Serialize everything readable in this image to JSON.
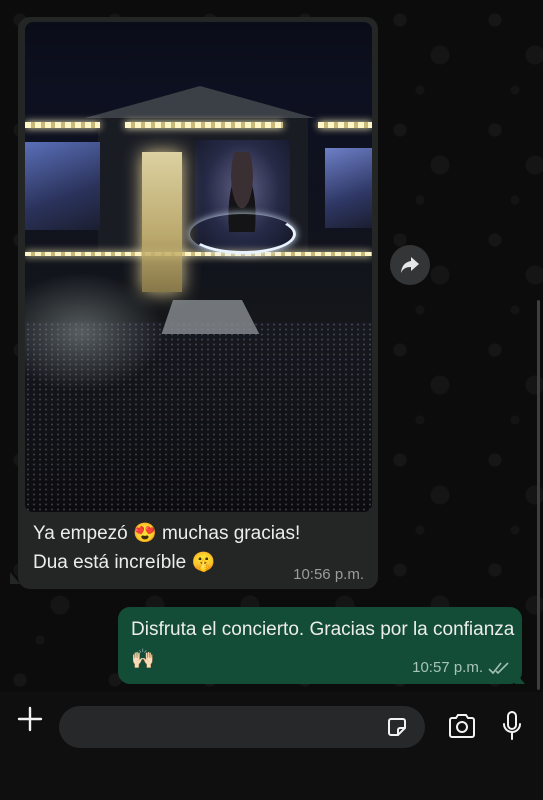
{
  "incoming": {
    "caption_line1": "Ya empezó",
    "emoji1": "😍",
    "caption_line1b": "muchas gracias!",
    "caption_line2": "Dua está increíble",
    "emoji2": "🤫",
    "time": "10:56 p.m.",
    "image_icon": "concert-photo"
  },
  "forward": {
    "icon": "forward-arrow-icon"
  },
  "outgoing": {
    "text": "Disfruta el concierto. Gracias por la confianza",
    "emoji": "🙌🏻",
    "time": "10:57 p.m.",
    "status": "read",
    "status_icon": "double-check-icon"
  },
  "input_bar": {
    "placeholder": "",
    "icons": [
      "plus-icon",
      "sticker-icon",
      "camera-icon",
      "microphone-icon"
    ]
  },
  "colors": {
    "incoming_bubble": "#242626",
    "outgoing_bubble": "#144d37",
    "background": "#0c0c0c"
  }
}
